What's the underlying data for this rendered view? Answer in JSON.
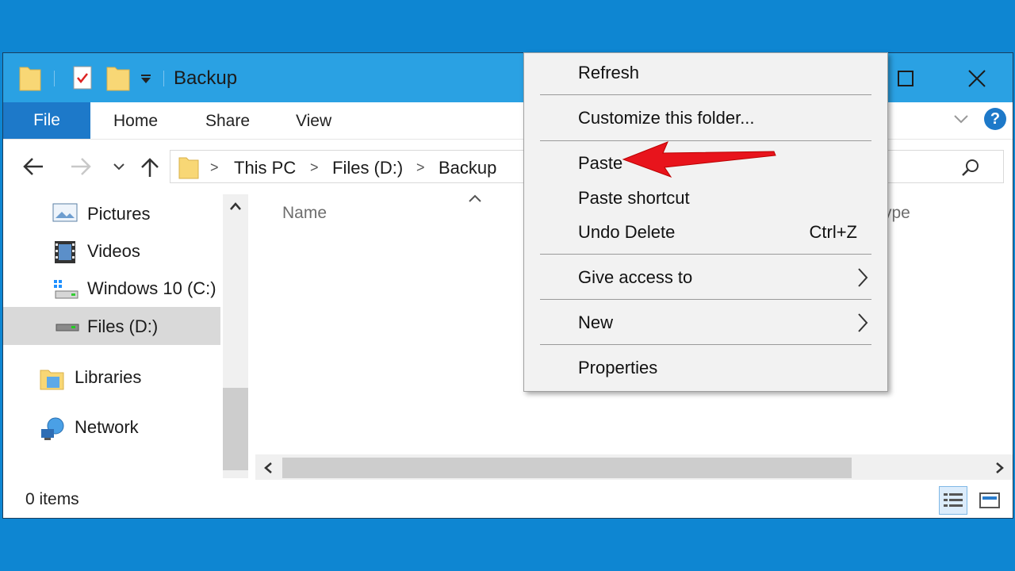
{
  "window": {
    "title": "Backup",
    "minimize_label": "",
    "accent": "#1d79c9",
    "titlebar_color": "#2aa1e3",
    "desktop_color": "#0e86d2"
  },
  "ribbon": {
    "tabs": [
      {
        "label": "File",
        "active": true
      },
      {
        "label": "Home"
      },
      {
        "label": "Share"
      },
      {
        "label": "View"
      }
    ],
    "help_label": "?"
  },
  "address": {
    "crumbs": [
      "This PC",
      "Files (D:)",
      "Backup"
    ],
    "separator": ">"
  },
  "nav": {
    "items": [
      {
        "label": "Pictures",
        "icon": "pictures-icon"
      },
      {
        "label": "Videos",
        "icon": "videos-icon"
      },
      {
        "label": "Windows 10 (C:)",
        "icon": "drive-c-icon"
      },
      {
        "label": "Files (D:)",
        "icon": "drive-d-icon",
        "selected": true
      },
      {
        "label": "Libraries",
        "icon": "libraries-icon"
      },
      {
        "label": "Network",
        "icon": "network-icon"
      }
    ]
  },
  "content": {
    "columns": [
      "Name",
      "ype"
    ]
  },
  "status": {
    "items": "0 items"
  },
  "context_menu": {
    "items": [
      {
        "label": "Refresh"
      },
      {
        "label": "Customize this folder..."
      },
      {
        "label": "Paste"
      },
      {
        "label": "Paste shortcut"
      },
      {
        "label": "Undo Delete",
        "shortcut": "Ctrl+Z"
      },
      {
        "label": "Give access to",
        "submenu": true
      },
      {
        "label": "New",
        "submenu": true
      },
      {
        "label": "Properties"
      }
    ]
  },
  "annotation": {
    "arrow_color": "#e8141c",
    "points_to": "Paste"
  }
}
